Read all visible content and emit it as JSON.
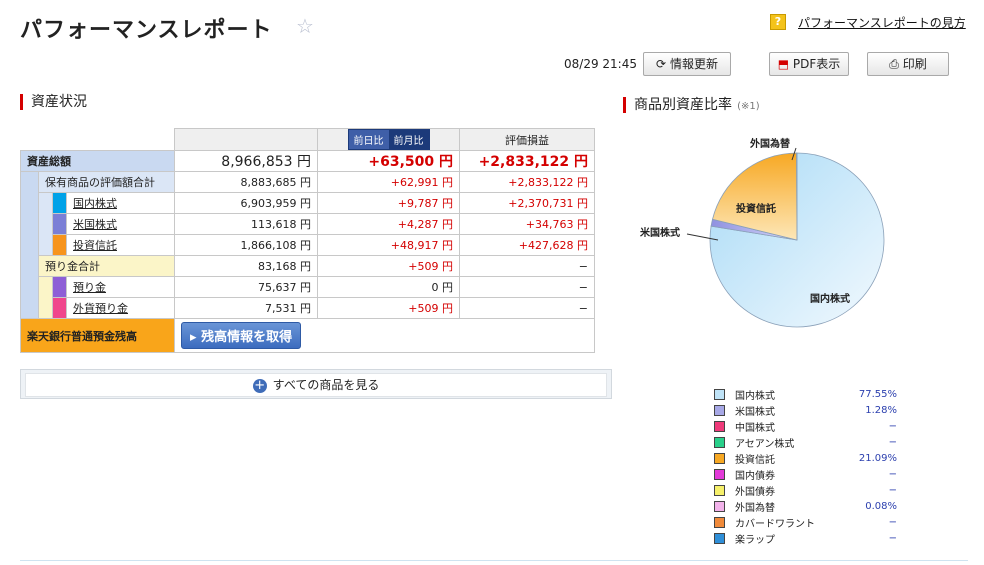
{
  "page_title": "パフォーマンスレポート",
  "help_link": "パフォーマンスレポートの見方",
  "timestamp": "08/29 21:45",
  "buttons": {
    "refresh": "情報更新",
    "pdf": "PDF表示",
    "print": "印刷"
  },
  "assets": {
    "section_title": "資産状況",
    "toggle": {
      "day": "前日比",
      "month": "前月比"
    },
    "col_pl": "評価損益",
    "total": {
      "label": "資産総額",
      "value": "8,966,853 円",
      "change": "+63,500 円",
      "pl": "+2,833,122 円"
    },
    "holdings": {
      "label": "保有商品の評価額合計",
      "value": "8,883,685 円",
      "change": "+62,991 円",
      "pl": "+2,833,122 円"
    },
    "items": [
      {
        "label": "国内株式",
        "value": "6,903,959 円",
        "change": "+9,787 円",
        "pl": "+2,370,731 円",
        "color": "#00a2e8"
      },
      {
        "label": "米国株式",
        "value": "113,618 円",
        "change": "+4,287 円",
        "pl": "+34,763 円",
        "color": "#7b7fd6"
      },
      {
        "label": "投資信託",
        "value": "1,866,108 円",
        "change": "+48,917 円",
        "pl": "+427,628 円",
        "color": "#f7941d"
      }
    ],
    "deposits": {
      "label": "預り金合計",
      "value": "83,168 円",
      "change": "+509 円",
      "pl": "−"
    },
    "deposit_items": [
      {
        "label": "預り金",
        "value": "75,637 円",
        "change": "0 円",
        "pl": "−",
        "color": "#8e5fd6"
      },
      {
        "label": "外貨預り金",
        "value": "7,531 円",
        "change": "+509 円",
        "pl": "−",
        "color": "#f0468c"
      }
    ],
    "bank": {
      "label": "楽天銀行普通預金残高",
      "button": "残高情報を取得"
    },
    "show_all": "すべての商品を見る"
  },
  "ratio": {
    "section_title": "商品別資産比率",
    "note": "(※1)",
    "pie_labels": {
      "fx": "外国為替",
      "fund": "投資信託",
      "us": "米国株式",
      "jp": "国内株式"
    },
    "legend": [
      {
        "name": "国内株式",
        "pct": "77.55%",
        "color": "#bfe3f7"
      },
      {
        "name": "米国株式",
        "pct": "1.28%",
        "color": "#a7a8e6"
      },
      {
        "name": "中国株式",
        "pct": "−",
        "color": "#ef3a7a"
      },
      {
        "name": "アセアン株式",
        "pct": "−",
        "color": "#29d08a"
      },
      {
        "name": "投資信託",
        "pct": "21.09%",
        "color": "#f7a823"
      },
      {
        "name": "国内債券",
        "pct": "−",
        "color": "#e23ad8"
      },
      {
        "name": "外国債券",
        "pct": "−",
        "color": "#f6f06a"
      },
      {
        "name": "外国為替",
        "pct": "0.08%",
        "color": "#f2b2ea"
      },
      {
        "name": "カバードワラント",
        "pct": "−",
        "color": "#f08a3a"
      },
      {
        "name": "楽ラップ",
        "pct": "−",
        "color": "#2f8fd8"
      }
    ]
  },
  "chart_data": {
    "type": "pie",
    "categories": [
      "国内株式",
      "米国株式",
      "投資信託",
      "外国為替"
    ],
    "values": [
      77.55,
      1.28,
      21.09,
      0.08
    ]
  }
}
